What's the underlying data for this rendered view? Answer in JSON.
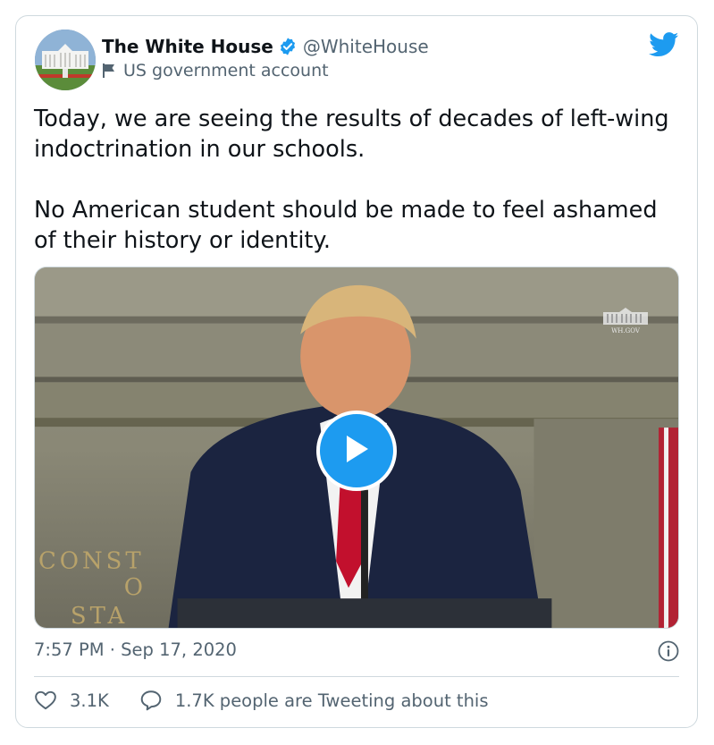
{
  "account": {
    "name": "The White House",
    "handle": "@WhiteHouse",
    "label": "US government account"
  },
  "tweet": {
    "paragraphs": [
      "Today, we are seeing the results of decades of left-wing indoctrination in our schools.",
      "No American student should be made to feel ashamed of their history or identity."
    ],
    "timestamp": "7:57 PM · Sep 17, 2020"
  },
  "video": {
    "watermark": "WH.GOV",
    "backdrop_text": [
      "CONST",
      "O",
      "STA"
    ]
  },
  "actions": {
    "likes": "3.1K",
    "conversation": "1.7K people are Tweeting about this"
  },
  "icons": {
    "verified": "verified-badge-icon",
    "flag": "flag-icon",
    "brand": "twitter-bird-icon",
    "play": "play-icon",
    "info": "info-icon",
    "like": "heart-icon",
    "reply": "speech-bubble-icon"
  },
  "colors": {
    "accent": "#1d9bf0",
    "text": "#0f1419",
    "secondary": "#536471",
    "border": "#cfd9de"
  }
}
